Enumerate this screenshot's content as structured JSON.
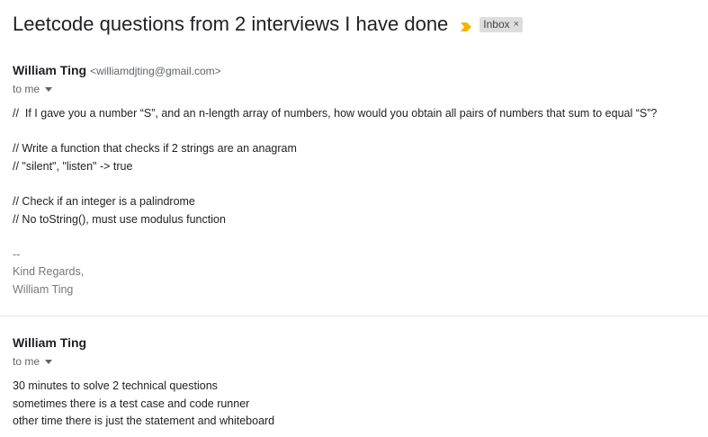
{
  "thread": {
    "subject": "Leetcode questions from 2 interviews I have done",
    "label": "Inbox",
    "label_remove": "×",
    "importance_icon": "importance-marker-icon",
    "importance_color": "#f4b400"
  },
  "messages": [
    {
      "sender_name": "William Ting",
      "sender_email": "<williamdjting@gmail.com>",
      "recipient": "to me",
      "body": [
        "//  If I gave you a number “S”, and an n-length array of numbers, how would you obtain all pairs of numbers that sum to equal “S”?",
        "",
        "// Write a function that checks if 2 strings are an anagram",
        "// \"silent\", \"listen\" -> true",
        "",
        "// Check if an integer is a palindrome",
        "// No toString(), must use modulus function",
        ""
      ],
      "signature": [
        "--",
        "Kind Regards,",
        "William Ting"
      ]
    },
    {
      "sender_name": "William Ting",
      "recipient": "to me",
      "body": [
        "30 minutes to solve 2 technical questions",
        "sometimes there is a test case and code runner",
        "other time there is just the statement and whiteboard"
      ]
    }
  ]
}
